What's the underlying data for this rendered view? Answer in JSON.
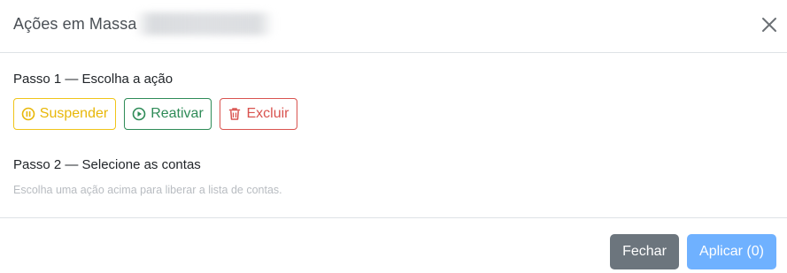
{
  "modal": {
    "title": "Ações em Massa"
  },
  "step1": {
    "title": "Passo 1 — Escolha a ação",
    "actions": {
      "suspend": {
        "label": "Suspender",
        "icon": "pause-circle-icon",
        "color": "#e8b708"
      },
      "reactivate": {
        "label": "Reativar",
        "icon": "play-circle-icon",
        "color": "#2e8b57"
      },
      "delete": {
        "label": "Excluir",
        "icon": "trash-icon",
        "color": "#d9534f"
      }
    }
  },
  "step2": {
    "title": "Passo 2 — Selecione as contas",
    "hint": "Escolha uma ação acima para liberar a lista de contas."
  },
  "footer": {
    "close_label": "Fechar",
    "apply_label": "Aplicar (0)",
    "close_color": "#6c757d",
    "apply_color": "#6fb1ff"
  }
}
